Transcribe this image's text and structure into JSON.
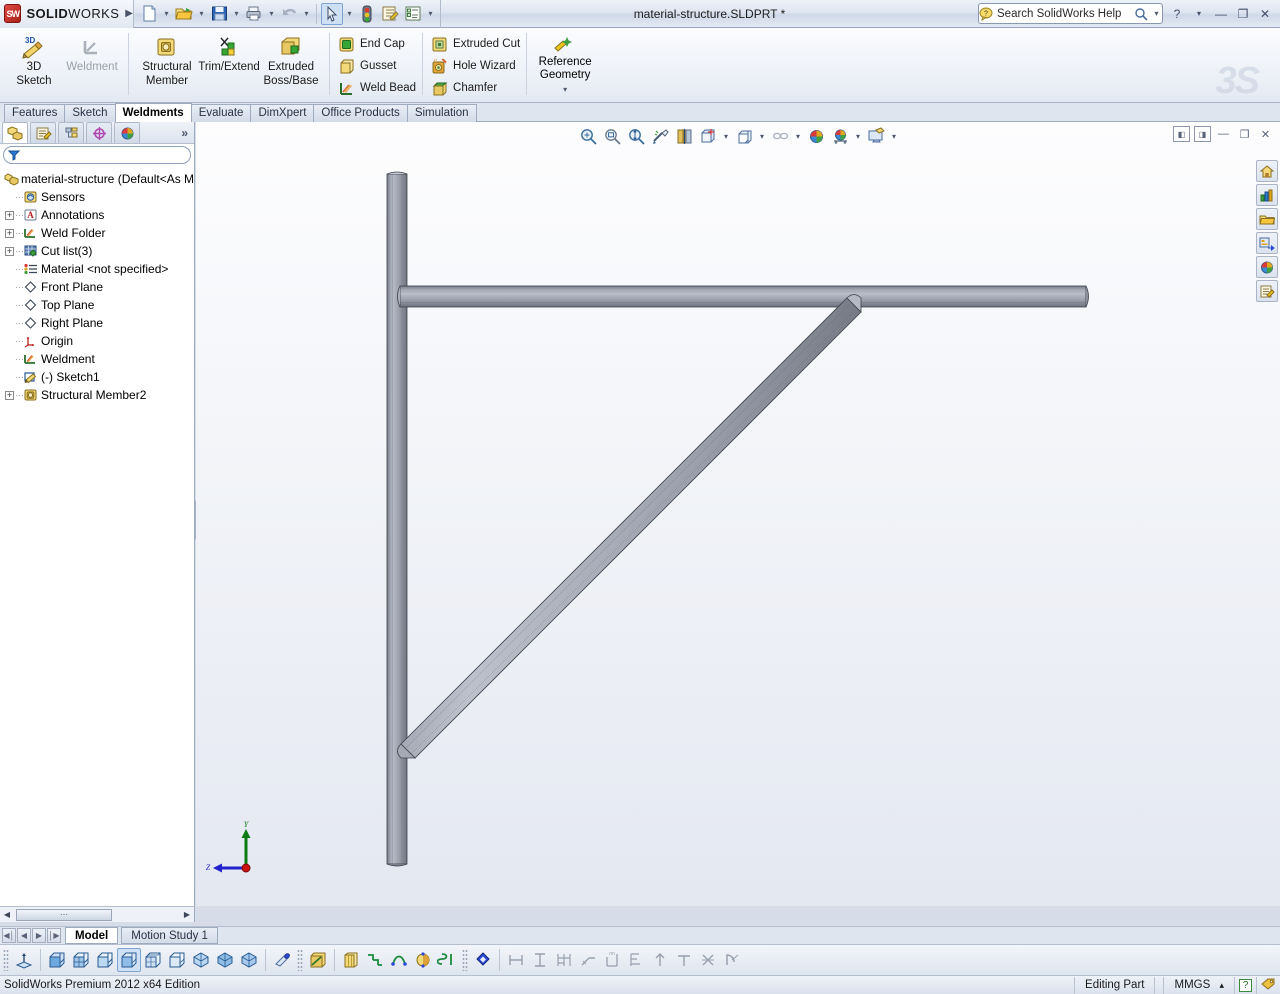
{
  "window": {
    "brand": "SOLIDWORKS",
    "brand_bold": "SOLID",
    "brand_light": "WORKS",
    "document_title": "material-structure.SLDPRT *",
    "brand_expand_arrow": "▶",
    "watermark": "3S"
  },
  "quick_access": {
    "items": [
      {
        "name": "new-document",
        "caret": true
      },
      {
        "name": "open-document",
        "caret": true
      },
      {
        "name": "save-document",
        "caret": true
      },
      {
        "name": "print-document",
        "caret": true
      },
      {
        "name": "undo",
        "caret": true,
        "disabled": true
      },
      {
        "name": "select",
        "caret": true,
        "selected": true
      },
      {
        "name": "rebuild",
        "caret": false
      },
      {
        "name": "options-editor",
        "caret": false
      },
      {
        "name": "options",
        "caret": true
      }
    ]
  },
  "help_search": {
    "value": "Search SolidWorks Help",
    "placeholder": "Search SolidWorks Help"
  },
  "window_buttons": {
    "help": "?",
    "help_caret": "▾",
    "minimize": "—",
    "restore": "❐",
    "close": "✕"
  },
  "ribbon": {
    "groups": [
      {
        "name": "sketch-group",
        "buttons": [
          {
            "label_line1": "3D",
            "label_line2": "Sketch",
            "icon": "3d-sketch-icon",
            "disabled": false
          },
          {
            "label_line1": "Weldment",
            "label_line2": "",
            "icon": "weldment-icon",
            "disabled": true
          }
        ]
      },
      {
        "name": "weldment-group",
        "buttons": [
          {
            "label_line1": "Structural",
            "label_line2": "Member",
            "icon": "structural-member-icon",
            "disabled": false
          },
          {
            "label_line1": "Trim/Extend",
            "label_line2": "",
            "icon": "trim-extend-icon",
            "disabled": false
          },
          {
            "label_line1": "Extruded",
            "label_line2": "Boss/Base",
            "icon": "extruded-boss-icon",
            "disabled": false
          }
        ]
      }
    ],
    "small_col_1": [
      {
        "label": "End Cap",
        "icon": "end-cap-icon"
      },
      {
        "label": "Gusset",
        "icon": "gusset-icon"
      },
      {
        "label": "Weld Bead",
        "icon": "weld-bead-icon"
      }
    ],
    "small_col_2": [
      {
        "label": "Extruded Cut",
        "icon": "extruded-cut-icon"
      },
      {
        "label": "Hole Wizard",
        "icon": "hole-wizard-icon"
      },
      {
        "label": "Chamfer",
        "icon": "chamfer-icon"
      }
    ],
    "reference_geometry": {
      "label_line1": "Reference",
      "label_line2": "Geometry",
      "icon": "reference-geometry-icon",
      "dropdown": "▾"
    }
  },
  "command_tabs": {
    "items": [
      {
        "label": "Features",
        "active": false
      },
      {
        "label": "Sketch",
        "active": false
      },
      {
        "label": "Weldments",
        "active": true
      },
      {
        "label": "Evaluate",
        "active": false
      },
      {
        "label": "DimXpert",
        "active": false
      },
      {
        "label": "Office Products",
        "active": false
      },
      {
        "label": "Simulation",
        "active": false
      }
    ]
  },
  "manager_panel": {
    "tabs": [
      {
        "name": "feature-manager-tab",
        "icon": "feature-tree-icon",
        "active": true
      },
      {
        "name": "property-manager-tab",
        "icon": "property-manager-icon",
        "active": false
      },
      {
        "name": "configuration-manager-tab",
        "icon": "configuration-manager-icon",
        "active": false
      },
      {
        "name": "dimxpert-manager-tab",
        "icon": "dimxpert-manager-icon",
        "active": false
      },
      {
        "name": "display-manager-tab",
        "icon": "display-manager-icon",
        "active": false
      }
    ],
    "more": "»",
    "filter_placeholder": ""
  },
  "feature_tree": {
    "items": [
      {
        "label": "material-structure  (Default<As M",
        "icon": "part-icon",
        "expand": "none",
        "indent": 0
      },
      {
        "label": "Sensors",
        "icon": "sensors-icon",
        "expand": "none",
        "indent": 1
      },
      {
        "label": "Annotations",
        "icon": "annotations-icon",
        "expand": "plus",
        "indent": 1
      },
      {
        "label": "Weld Folder",
        "icon": "weld-folder-icon",
        "expand": "plus",
        "indent": 1
      },
      {
        "label": "Cut list(3)",
        "icon": "cut-list-icon",
        "expand": "plus",
        "indent": 1
      },
      {
        "label": "Material <not specified>",
        "icon": "material-icon",
        "expand": "none",
        "indent": 1
      },
      {
        "label": "Front Plane",
        "icon": "plane-icon",
        "expand": "none",
        "indent": 1
      },
      {
        "label": "Top Plane",
        "icon": "plane-icon",
        "expand": "none",
        "indent": 1
      },
      {
        "label": "Right Plane",
        "icon": "plane-icon",
        "expand": "none",
        "indent": 1
      },
      {
        "label": "Origin",
        "icon": "origin-icon",
        "expand": "none",
        "indent": 1
      },
      {
        "label": "Weldment",
        "icon": "weldment-feature-icon",
        "expand": "none",
        "indent": 1
      },
      {
        "label": "(-) Sketch1",
        "icon": "sketch-icon",
        "expand": "none",
        "indent": 1
      },
      {
        "label": "Structural Member2",
        "icon": "structural-member-feature-icon",
        "expand": "plus",
        "indent": 1
      }
    ]
  },
  "view_toolbar": {
    "items": [
      {
        "name": "zoom-to-fit-icon",
        "caret": false
      },
      {
        "name": "zoom-to-area-icon",
        "caret": false
      },
      {
        "name": "zoom-in-out-icon",
        "caret": false
      },
      {
        "name": "previous-view-icon",
        "caret": false
      },
      {
        "name": "section-view-icon",
        "caret": false
      },
      {
        "name": "view-orientation-icon",
        "caret": true
      },
      {
        "name": "display-style-icon",
        "caret": true
      },
      {
        "name": "hide-show-items-icon",
        "caret": true,
        "disabled": true
      },
      {
        "name": "edit-appearance-icon",
        "caret": false
      },
      {
        "name": "apply-scene-icon",
        "caret": true
      },
      {
        "name": "view-settings-icon",
        "caret": true
      }
    ],
    "window_controls": [
      {
        "name": "restore-panel-left-icon",
        "glyph": "◧"
      },
      {
        "name": "restore-panel-right-icon",
        "glyph": "◨"
      },
      {
        "name": "minimize-doc-icon",
        "glyph": "—"
      },
      {
        "name": "restore-doc-icon",
        "glyph": "❐"
      },
      {
        "name": "close-doc-icon",
        "glyph": "✕"
      }
    ]
  },
  "task_pane": {
    "items": [
      {
        "name": "solidworks-resources-icon"
      },
      {
        "name": "design-library-icon"
      },
      {
        "name": "file-explorer-icon"
      },
      {
        "name": "view-palette-icon"
      },
      {
        "name": "appearances-scenes-icon"
      },
      {
        "name": "custom-properties-icon"
      }
    ]
  },
  "triad": {
    "y_label": "Y",
    "z_label": "Z",
    "y_color": "#0a7a12",
    "z_color": "#2222cc",
    "origin_color": "#cc1111"
  },
  "model": {
    "name": "weldment-frame",
    "face_light": "#b7bbc6",
    "face_mid": "#8d919d",
    "face_dark": "#6e7280",
    "edge_color": "#3a3d46",
    "members": [
      {
        "name": "vertical-column",
        "type": "square-tube"
      },
      {
        "name": "horizontal-beam",
        "type": "square-tube"
      },
      {
        "name": "diagonal-brace",
        "type": "square-tube"
      }
    ]
  },
  "panel_scroll": {
    "left_arrow": "◀",
    "right_arrow": "▶",
    "thumb_grip": "‖"
  },
  "document_tabs": {
    "nav": [
      "◀│",
      "◀",
      "▶",
      "│▶"
    ],
    "tabs": [
      {
        "label": "Model",
        "active": true
      },
      {
        "label": "Motion Study 1",
        "active": false
      }
    ]
  },
  "bottom_toolbars": {
    "standard_views": [
      {
        "name": "normal-to-icon",
        "selected": false
      },
      {
        "name": "front-view-icon",
        "selected": false
      },
      {
        "name": "back-view-icon",
        "selected": false
      },
      {
        "name": "left-view-icon",
        "selected": false
      },
      {
        "name": "right-view-icon",
        "selected": true
      },
      {
        "name": "top-view-icon",
        "selected": false
      },
      {
        "name": "bottom-view-icon",
        "selected": false
      },
      {
        "name": "isometric-view-icon",
        "selected": false
      },
      {
        "name": "trimetric-view-icon",
        "selected": false
      },
      {
        "name": "dimetric-view-icon",
        "selected": false
      },
      {
        "name": "single-view-icon",
        "selected": false
      }
    ],
    "weldment_tools": [
      {
        "name": "structural-member-tool-icon"
      },
      {
        "name": "extruded-boss-tool-icon"
      },
      {
        "name": "trim-extend-tool-icon"
      },
      {
        "name": "end-cap-tool-icon"
      },
      {
        "name": "gusset-tool-icon"
      },
      {
        "name": "weld-bead-tool-icon"
      }
    ],
    "dimension_tools": [
      {
        "name": "smart-dimension-icon"
      },
      {
        "name": "horizontal-dimension-icon"
      },
      {
        "name": "vertical-dimension-icon"
      },
      {
        "name": "baseline-dimension-icon"
      },
      {
        "name": "chamfer-dimension-icon"
      },
      {
        "name": "ordinate-dimension-icon"
      },
      {
        "name": "horizontal-ordinate-icon"
      },
      {
        "name": "vertical-ordinate-icon"
      },
      {
        "name": "attach-dimension-icon"
      },
      {
        "name": "path-length-dimension-icon"
      },
      {
        "name": "fully-define-sketch-icon"
      }
    ]
  },
  "status_bar": {
    "edition": "SolidWorks Premium 2012 x64 Edition",
    "editing_state": "Editing Part",
    "units": "MMGS",
    "units_caret": "▴",
    "help_glyph": "?",
    "tag_icon": "tag-icon"
  }
}
